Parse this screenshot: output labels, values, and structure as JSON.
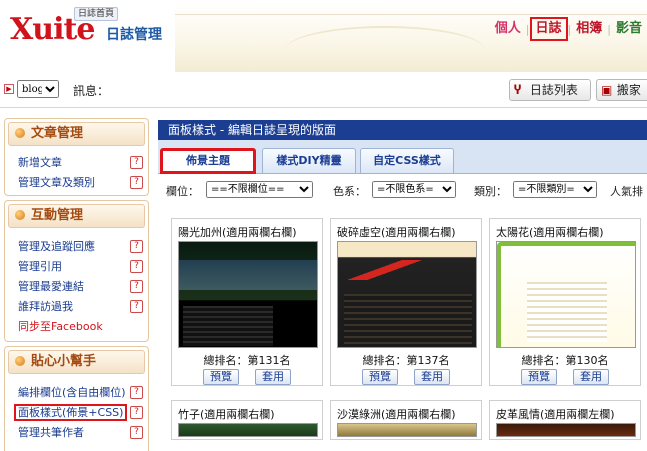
{
  "header": {
    "logo_text": "Xuite",
    "logo_tag": "日誌首頁",
    "app_title": "日誌管理",
    "nav": [
      "個人",
      "日誌",
      "相簿",
      "影音"
    ]
  },
  "subbar": {
    "blog_select": "blog",
    "message_label": "訊息：",
    "list_button": "日誌列表",
    "move_button": "搬家"
  },
  "sidebar": {
    "sections": [
      {
        "title": "文章管理",
        "items": [
          "新增文章",
          "管理文章及類別"
        ]
      },
      {
        "title": "互動管理",
        "items": [
          "管理及追蹤回應",
          "管理引用",
          "管理最愛連結",
          "誰拜訪過我",
          "同步至Facebook"
        ]
      },
      {
        "title": "貼心小幫手",
        "items": [
          "編排欄位(含自由欄位)",
          "面板樣式(佈景+CSS)",
          "管理共筆作者"
        ]
      }
    ],
    "help_glyph": "?"
  },
  "main": {
    "title": "面板樣式 - 編輯日誌呈現的版面",
    "tabs": [
      "佈景主題",
      "樣式DIY精靈",
      "自定CSS樣式"
    ],
    "filters": {
      "column_label": "欄位：",
      "column_value": "==不限欄位==",
      "color_label": "色系：",
      "color_value": "=不限色系=",
      "category_label": "類別：",
      "category_value": "=不限類別=",
      "popular_label": "人氣排"
    },
    "themes": [
      {
        "name": "陽光加州(適用兩欄右欄)",
        "rank": "總排名：第131名"
      },
      {
        "name": "破碎虛空(適用兩欄右欄)",
        "rank": "總排名：第137名"
      },
      {
        "name": "太陽花(適用兩欄右欄)",
        "rank": "總排名：第130名"
      }
    ],
    "themes_next": [
      {
        "name": "竹子(適用兩欄右欄)"
      },
      {
        "name": "沙漠綠洲(適用兩欄右欄)"
      },
      {
        "name": "皮革風情(適用兩欄左欄)"
      }
    ],
    "preview_label": "預覽",
    "apply_label": "套用"
  }
}
